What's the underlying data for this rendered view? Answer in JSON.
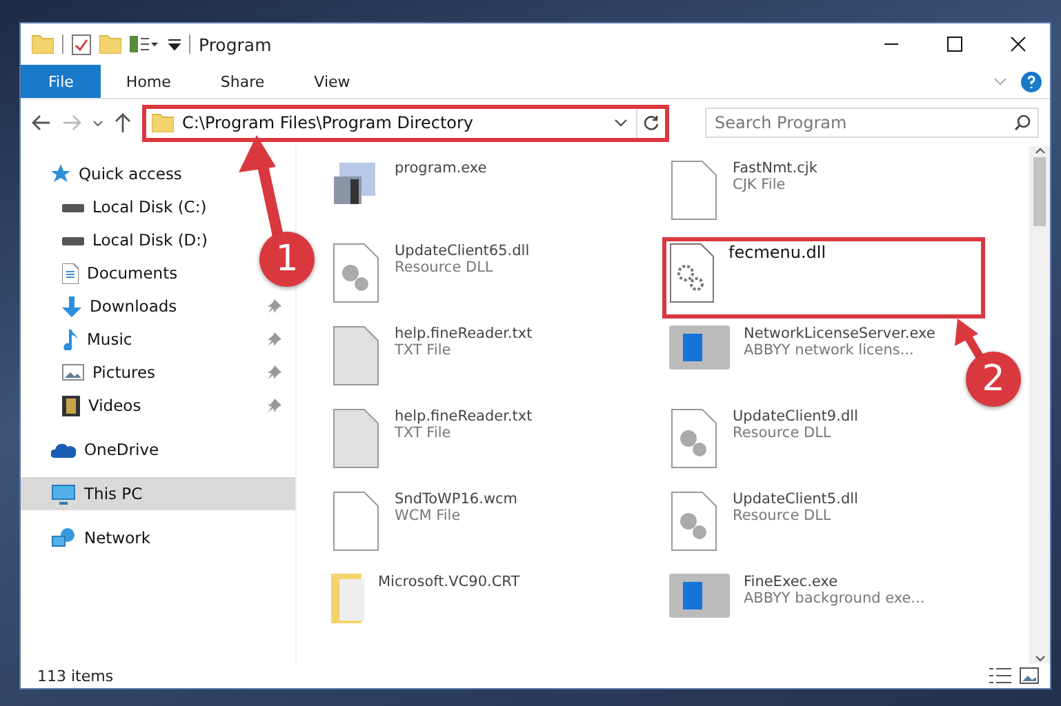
{
  "window": {
    "title": "Program"
  },
  "ribbon_tabs": [
    {
      "label": "File",
      "selected": true
    },
    {
      "label": "Home",
      "selected": false
    },
    {
      "label": "Share",
      "selected": false
    },
    {
      "label": "View",
      "selected": false
    }
  ],
  "address_bar": {
    "path": "C:\\Program Files\\Program Directory",
    "highlighted": true
  },
  "search": {
    "placeholder": "Search Program"
  },
  "sidebar": {
    "items": [
      {
        "label": "Quick access",
        "kind": "star",
        "selected": false,
        "children": [
          {
            "label": "Local Disk (C:)",
            "kind": "disk",
            "pinned": false
          },
          {
            "label": "Local Disk (D:)",
            "kind": "disk",
            "pinned": false
          },
          {
            "label": "Documents",
            "kind": "doc",
            "pinned": false
          },
          {
            "label": "Downloads",
            "kind": "download",
            "pinned": true
          },
          {
            "label": "Music",
            "kind": "music",
            "pinned": true
          },
          {
            "label": "Pictures",
            "kind": "pictures",
            "pinned": true
          },
          {
            "label": "Videos",
            "kind": "videos",
            "pinned": true
          }
        ]
      },
      {
        "label": "OneDrive",
        "kind": "cloud",
        "selected": false
      },
      {
        "label": "This PC",
        "kind": "pc",
        "selected": true
      },
      {
        "label": "Network",
        "kind": "network",
        "selected": false
      }
    ]
  },
  "files": [
    {
      "name": "program.exe",
      "kind": "app",
      "highlighted": false
    },
    {
      "name": "FastNmt.cjk",
      "type": "CJK File",
      "kind": "file",
      "highlighted": false
    },
    {
      "name": "UpdateClient65.dll",
      "type": "Resource DLL",
      "kind": "dll",
      "highlighted": false
    },
    {
      "name": "fecmenu.dll",
      "kind": "gears",
      "highlighted": true
    },
    {
      "name": "help.fineReader.txt",
      "type": "TXT File",
      "kind": "txt",
      "highlighted": false
    },
    {
      "name": "NetworkLicenseServer.exe",
      "type": "ABBYY network licens...",
      "kind": "exe",
      "highlighted": false
    },
    {
      "name": "help.fineReader.txt",
      "type": "TXT File",
      "kind": "txt",
      "highlighted": false
    },
    {
      "name": "UpdateClient9.dll",
      "type": "Resource DLL",
      "kind": "dll",
      "highlighted": false
    },
    {
      "name": "SndToWP16.wcm",
      "type": "WCM File",
      "kind": "file",
      "highlighted": false
    },
    {
      "name": "UpdateClient5.dll",
      "type": "Resource DLL",
      "kind": "dll",
      "highlighted": false
    },
    {
      "name": "Microsoft.VC90.CRT",
      "kind": "folder",
      "highlighted": false
    },
    {
      "name": "FineExec.exe",
      "type": "ABBYY background exe...",
      "kind": "exe",
      "highlighted": false
    }
  ],
  "status_bar": {
    "count": "113 items"
  },
  "annotations": [
    "1",
    "2"
  ]
}
